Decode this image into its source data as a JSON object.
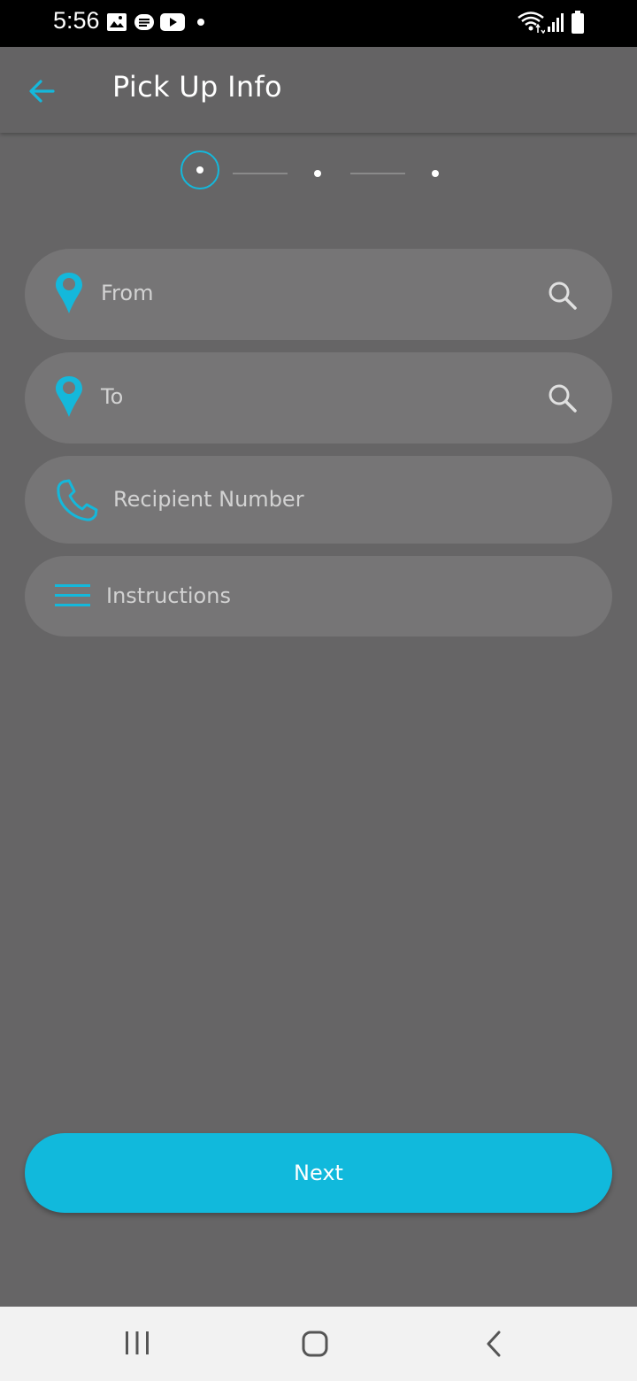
{
  "status_bar": {
    "time": "5:56",
    "left_icons": [
      "image-icon",
      "message-icon",
      "youtube-icon",
      "dot-icon"
    ],
    "right_icons": [
      "wifi-icon",
      "signal-icon",
      "battery-icon"
    ]
  },
  "header": {
    "title": "Pick Up Info",
    "back_icon": "arrow-left-icon"
  },
  "stepper": {
    "current_step": 1,
    "total_steps": 3
  },
  "form": {
    "from": {
      "placeholder": "From",
      "icon": "location-pin-icon",
      "action_icon": "search-icon"
    },
    "to": {
      "placeholder": "To",
      "icon": "location-pin-icon",
      "action_icon": "search-icon"
    },
    "recipient": {
      "placeholder": "Recipient Number",
      "icon": "phone-icon"
    },
    "instructions": {
      "placeholder": "Instructions",
      "icon": "menu-lines-icon"
    }
  },
  "actions": {
    "next_label": "Next"
  },
  "nav_bar": {
    "buttons": [
      "recent-apps-icon",
      "home-icon",
      "back-icon"
    ]
  },
  "colors": {
    "accent": "#11b9dc",
    "background": "#666566",
    "field": "#767576",
    "header": "#646364"
  }
}
